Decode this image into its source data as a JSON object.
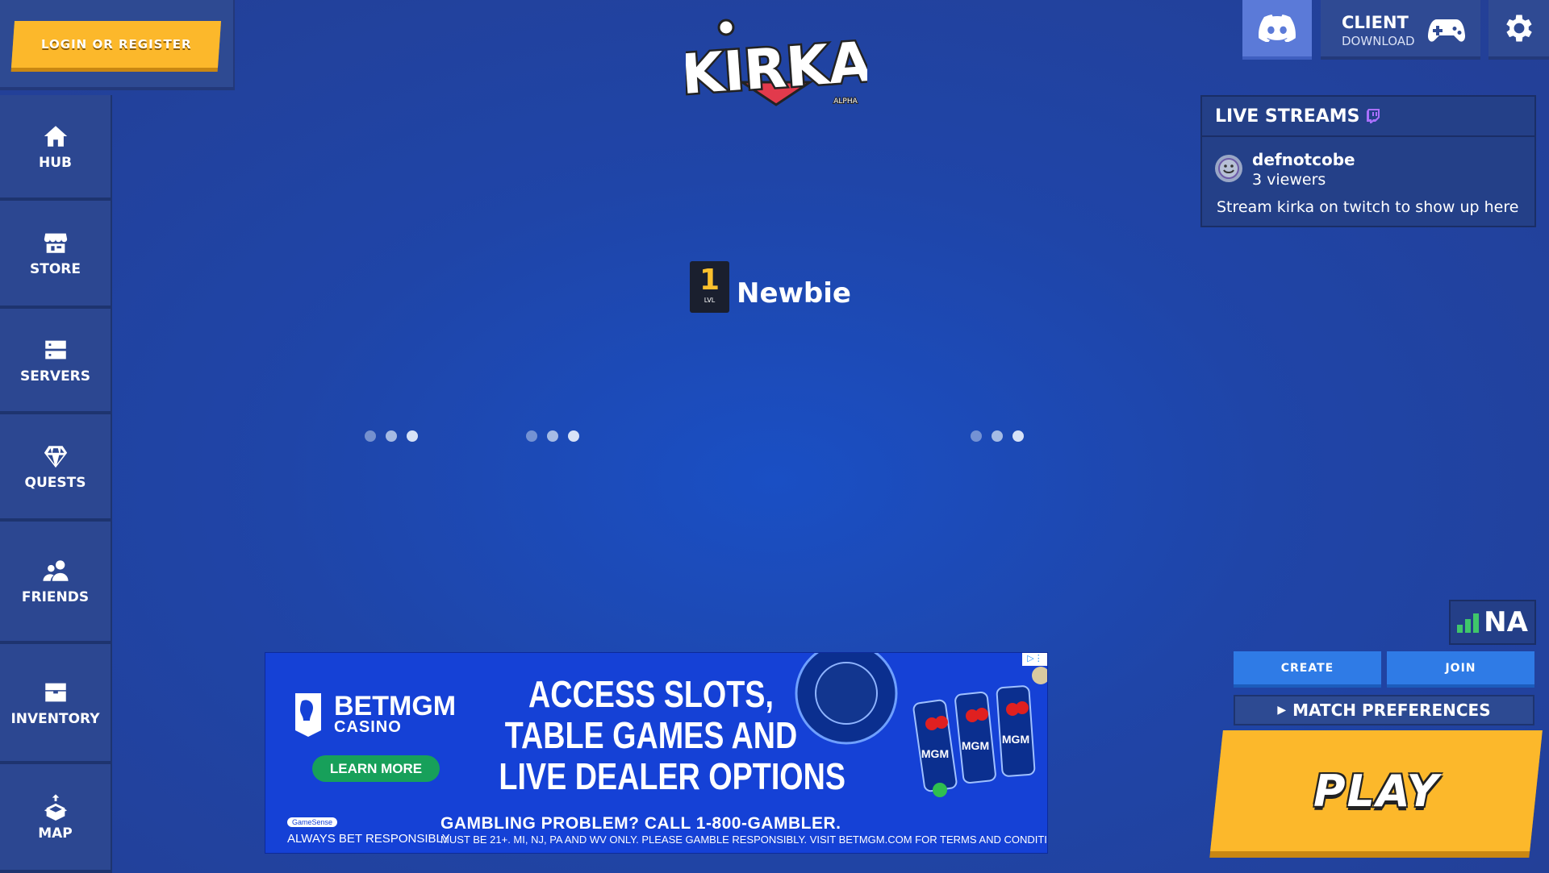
{
  "login": {
    "label": "LOGIN OR REGISTER"
  },
  "sidebar": {
    "items": [
      {
        "label": "HUB",
        "icon": "home-icon"
      },
      {
        "label": "STORE",
        "icon": "store-icon"
      },
      {
        "label": "SERVERS",
        "icon": "servers-icon"
      },
      {
        "label": "QUESTS",
        "icon": "diamond-icon"
      },
      {
        "label": "FRIENDS",
        "icon": "friends-icon"
      },
      {
        "label": "INVENTORY",
        "icon": "chest-icon"
      },
      {
        "label": "MAP",
        "icon": "map-icon"
      }
    ]
  },
  "logo": {
    "text": "KIRKA",
    "subtext": "ALPHA"
  },
  "topbar": {
    "client_label": "CLIENT",
    "client_sub": "DOWNLOAD",
    "discord_icon": "discord-icon",
    "settings_icon": "gear-icon"
  },
  "streams": {
    "title": "LIVE STREAMS",
    "entries": [
      {
        "name": "defnotcobe",
        "viewers": "3 viewers"
      }
    ],
    "note": "Stream kirka on twitch to show up here"
  },
  "player": {
    "level": "1",
    "level_label": "LVL",
    "name": "Newbie"
  },
  "ad": {
    "brand_top": "BETMGM",
    "brand_bottom": "CASINO",
    "learn_more": "LEARN MORE",
    "headline_1": "ACCESS SLOTS,",
    "headline_2": "TABLE GAMES AND",
    "headline_3": "LIVE DEALER OPTIONS",
    "problem": "GAMBLING PROBLEM? CALL 1-800-GAMBLER.",
    "disclaimer": "MUST BE 21+. MI, NJ, PA AND WV ONLY. PLEASE GAMBLE RESPONSIBLY. VISIT BETMGM.COM FOR TERMS AND CONDITIONS.",
    "gamesense": "GameSense",
    "always": "ALWAYS BET RESPONSIBLY",
    "reel_text": "MGM"
  },
  "controls": {
    "region": "NA",
    "create": "CREATE",
    "join": "JOIN",
    "match_preferences": "MATCH PREFERENCES",
    "play": "PLAY"
  },
  "colors": {
    "accent_yellow": "#fcb82b",
    "panel_blue": "#2c4791",
    "button_blue": "#2f7be6",
    "discord": "#5b7ad8",
    "ping_green": "#3fc66a"
  }
}
